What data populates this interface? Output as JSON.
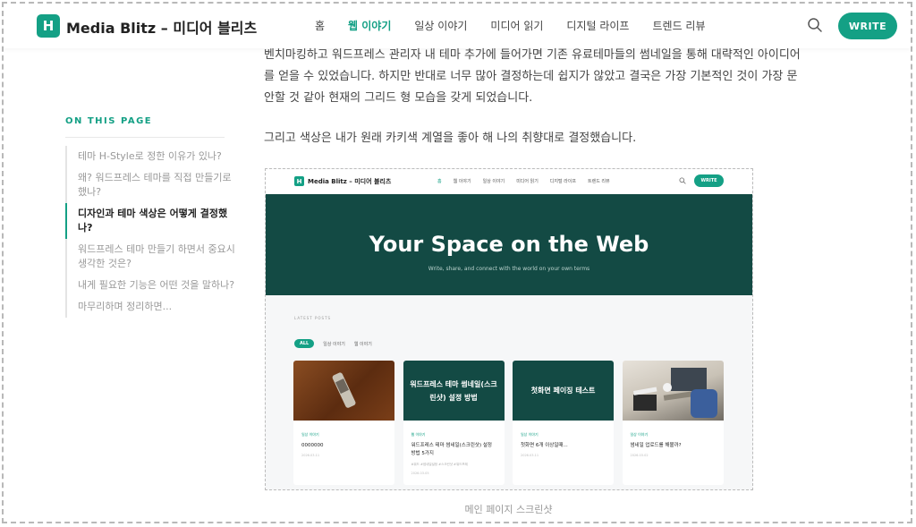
{
  "header": {
    "logo_letter": "H",
    "site_title": "Media Blitz – 미디어 블리츠",
    "nav": [
      {
        "label": "홈",
        "active": false
      },
      {
        "label": "웹 이야기",
        "active": true
      },
      {
        "label": "일상 이야기",
        "active": false
      },
      {
        "label": "미디어 읽기",
        "active": false
      },
      {
        "label": "디지털 라이프",
        "active": false
      },
      {
        "label": "트렌드 리뷰",
        "active": false
      }
    ],
    "write_label": "WRITE",
    "search_icon": "search-icon"
  },
  "toc": {
    "heading": "ON THIS PAGE",
    "items": [
      {
        "label": "테마 H-Style로 정한 이유가 있나?",
        "active": false
      },
      {
        "label": "왜? 워드프레스 테마를 직접 만들기로 했나?",
        "active": false
      },
      {
        "label": "디자인과 테마 색상은 어떻게 결정했나?",
        "active": true
      },
      {
        "label": "워드프레스 테마 만들기 하면서 중요시 생각한 것은?",
        "active": false
      },
      {
        "label": "내게 필요한 기능은 어떤 것을 말하나?",
        "active": false
      },
      {
        "label": "마무리하며 정리하면...",
        "active": false
      }
    ]
  },
  "article": {
    "paragraph1": "벤치마킹하고 워드프레스 관리자 내 테마 추가에 들어가면 기존 유료테마들의 썸네일을 통해 대략적인 아이디어를 얻을 수 있었습니다. 하지만 반대로 너무 많아 결정하는데 쉽지가 않았고 결국은 가장 기본적인 것이 가장 문안할 것 같아 현재의 그리드 형 모습을 갖게 되었습니다.",
    "paragraph2": "그리고 색상은 내가 원래 카키색 계열을 좋아 해 나의 취향대로 결정했습니다.",
    "caption": "메인 페이지 스크린샷"
  },
  "screenshot": {
    "logo_letter": "H",
    "site_title": "Media Blitz – 미디어 블리츠",
    "nav": [
      {
        "label": "홈",
        "active": true
      },
      {
        "label": "웹 이야기",
        "active": false
      },
      {
        "label": "일상 이야기",
        "active": false
      },
      {
        "label": "미디어 읽기",
        "active": false
      },
      {
        "label": "디지털 라이프",
        "active": false
      },
      {
        "label": "트렌드 리뷰",
        "active": false
      }
    ],
    "write_label": "WRITE",
    "hero_title": "Your Space on the Web",
    "hero_subtitle": "Write, share, and connect with the world on your own terms",
    "latest_label": "LATEST POSTS",
    "filters": [
      {
        "label": "ALL",
        "active": true
      },
      {
        "label": "일상 이야기",
        "active": false
      },
      {
        "label": "웹 이야기",
        "active": false
      }
    ],
    "cards": [
      {
        "thumb_text": "",
        "category": "일상 이야기",
        "title": "0000000",
        "extra": "",
        "date": "2026.03.11"
      },
      {
        "thumb_text": "워드프레스 테마 썸네일(스크린샷) 설정 방법",
        "category": "웹 이야기",
        "title": "워드프레스 테마 썸네일(스크린샷) 설정 방법 5가지",
        "extra": "#워드 #썸네일설정 #스크린샷 #워드프레",
        "date": "2026.03.05"
      },
      {
        "thumb_text": "첫화면 페이징 테스트",
        "category": "일상 이야기",
        "title": "첫화면 6개 이상일때...",
        "extra": "",
        "date": "2026.03.11"
      },
      {
        "thumb_text": "",
        "category": "일상 이야기",
        "title": "썸네일 업로드를 해볼까?",
        "extra": "",
        "date": "2026.03.02"
      }
    ]
  },
  "colors": {
    "accent": "#14a085",
    "hero_bg": "#134a44"
  }
}
